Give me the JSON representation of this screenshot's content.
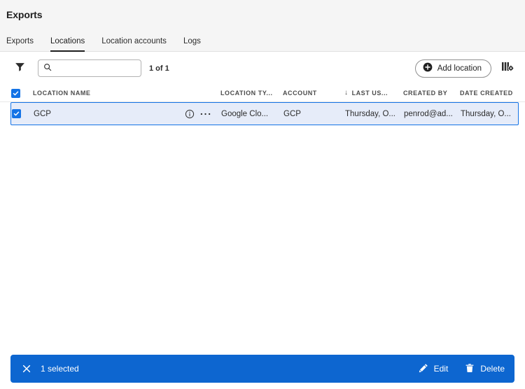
{
  "header": {
    "title": "Exports"
  },
  "tabs": [
    {
      "label": "Exports",
      "active": false
    },
    {
      "label": "Locations",
      "active": true
    },
    {
      "label": "Location accounts",
      "active": false
    },
    {
      "label": "Logs",
      "active": false
    }
  ],
  "toolbar": {
    "filter_icon": "filter-funnel-icon",
    "search": {
      "value": "",
      "placeholder": "",
      "icon": "search-icon"
    },
    "count_label": "1 of 1",
    "add_button_label": "Add location",
    "add_button_icon": "add-circle-icon",
    "columns_button_icon": "column-settings-icon"
  },
  "table": {
    "columns": [
      {
        "key": "name",
        "label": "LOCATION NAME",
        "sorted": false
      },
      {
        "key": "type",
        "label": "LOCATION TY...",
        "sorted": false
      },
      {
        "key": "account",
        "label": "ACCOUNT",
        "sorted": false
      },
      {
        "key": "last_used",
        "label": "LAST US...",
        "sorted": true,
        "sort_direction": "desc",
        "sort_arrow": "↓"
      },
      {
        "key": "created_by",
        "label": "CREATED BY",
        "sorted": false
      },
      {
        "key": "date_created",
        "label": "DATE CREATED",
        "sorted": false
      }
    ],
    "select_all_checked": true,
    "rows": [
      {
        "selected": true,
        "name": "GCP",
        "info_icon": "info-circle-icon",
        "more_icon": "more-horizontal-icon",
        "type": "Google Clo...",
        "account": "GCP",
        "last_used": "Thursday, O...",
        "created_by": "penrod@ad...",
        "date_created": "Thursday, O..."
      }
    ]
  },
  "action_bar": {
    "close_icon": "close-icon",
    "selected_label": "1 selected",
    "edit_label": "Edit",
    "edit_icon": "pencil-icon",
    "delete_label": "Delete",
    "delete_icon": "trash-icon",
    "background_color": "#0d66d0"
  },
  "colors": {
    "accent_blue": "#1473e6",
    "action_bar_blue": "#0d66d0",
    "selected_row_bg": "#e6ecf9",
    "header_bg": "#f5f5f5"
  }
}
